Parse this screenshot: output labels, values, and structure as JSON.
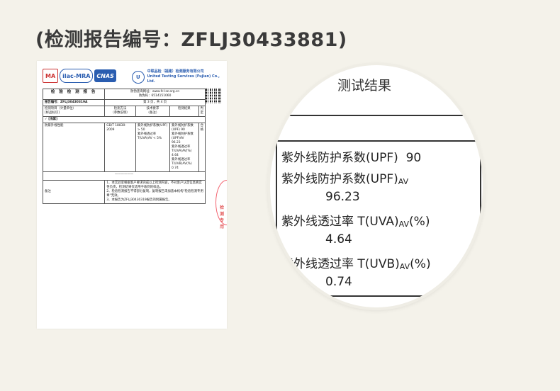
{
  "heading": "(检测报告编号：ZFLJ30433881)",
  "report": {
    "logos": [
      "MA",
      "ilac-MRA",
      "CNAS"
    ],
    "lab_name_cn": "中联品检（福建）检测服务有限公司",
    "lab_name_en": "United Testing Services (Fujian) Co., Ltd.",
    "title": "检 验 检 测 报 告",
    "report_no_label": "报告编号：",
    "report_no": "ZFLJ30430319A",
    "query_site": "防伪查询网址：www.fcl-sz.org.cn",
    "query_code": "防伪码：6514151060",
    "page_info": "第 3 页，共 4 页",
    "columns": [
      "检测项目（计量单位）\n[样品标识]",
      "检测方法\n（参数说明）",
      "技术要求\n（备注）",
      "检测结果",
      "判定"
    ],
    "section": "✓  [浅紫]",
    "row": {
      "item": "防紫外线性能",
      "method": "GB/T 18830-2009",
      "requirement": "紫外线防护系数(UPF) > 50\n紫外线透过率T(UVA)AV < 5%",
      "result": "紫外线防护系数(UPF)  90\n紫外线防护系数(UPF)AV\n96.23\n紫外线透过率 T(UVA)AV(%)\n4.64\n紫外线透过率 T(UVB)AV(%)\n0.74",
      "verdict": "合格"
    },
    "notes_label": "备注",
    "notes": "1、本实验室根据客户要求完成以上检测内容，不对客户认定信息真实性负责，检测结果仅适用于收到的样品。\n2、检验检测报告不得部分复制，复制报告未加盖本机构\"检验检测专用章\"无效。\n3、本报告为ZFLJ30430319报告的附属报告。",
    "stamp_text": "检测专用"
  },
  "magnified": {
    "header": "测试结果",
    "rows": [
      {
        "label": "紫外线防护系数(UPF)",
        "sub": "",
        "suffix": "",
        "value": "90"
      },
      {
        "label": "紫外线防护系数(UPF)",
        "sub": "AV",
        "suffix": "",
        "value": "96.23"
      },
      {
        "label": "紫外线透过率 T(UVA)",
        "sub": "AV",
        "suffix": "(%)",
        "value": "4.64"
      },
      {
        "label": "紫外线透过率 T(UVB)",
        "sub": "AV",
        "suffix": "(%)",
        "value": "0.74"
      }
    ]
  },
  "colors": {
    "background": "#f4f2ea",
    "stamp": "#e22233",
    "accent_blue": "#2a5db0"
  }
}
